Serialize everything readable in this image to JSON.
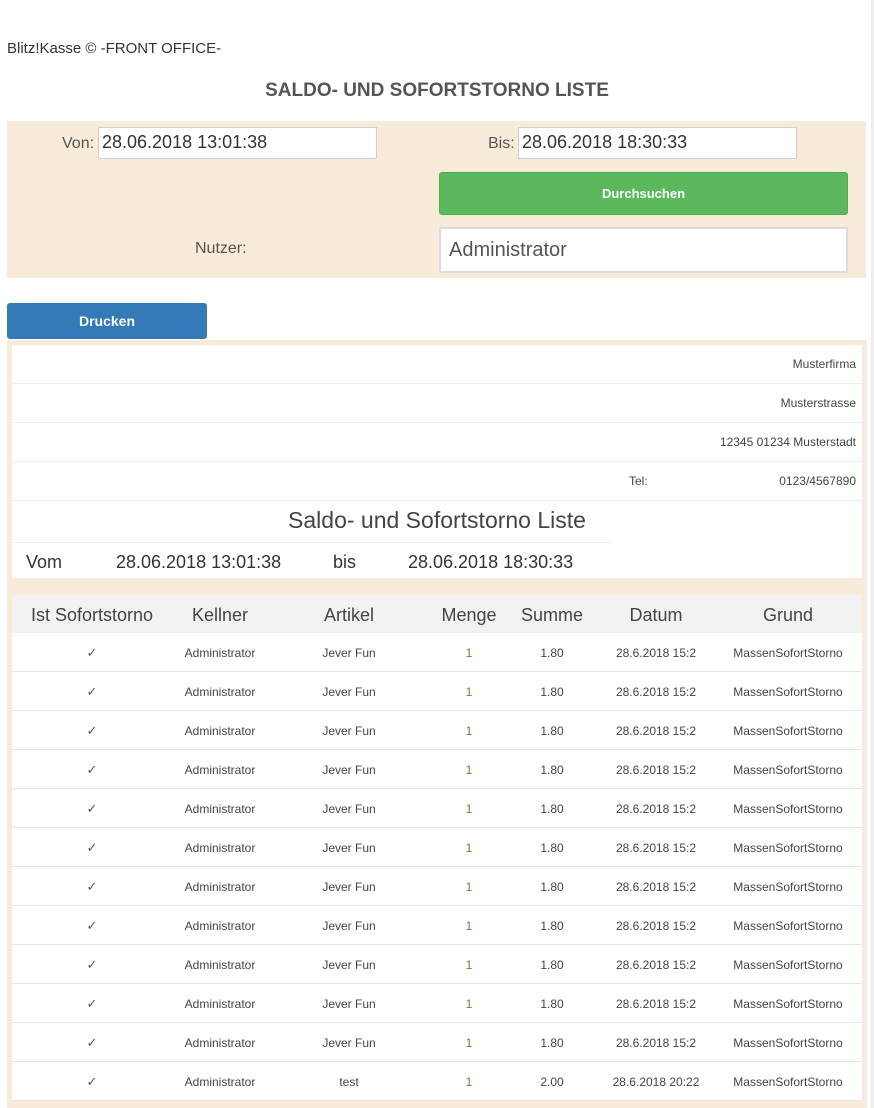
{
  "app": {
    "title": "Blitz!Kasse © -FRONT OFFICE-"
  },
  "page": {
    "heading": "SALDO- UND SOFORTSTORNO LISTE"
  },
  "filters": {
    "from_label": "Von:",
    "from_value": "28.06.2018 13:01:38",
    "to_label": "Bis:",
    "to_value": "28.06.2018 18:30:33",
    "search_button": "Durchsuchen",
    "user_label": "Nutzer:",
    "user_value": "Administrator"
  },
  "print_button": "Drucken",
  "report": {
    "company": "Musterfirma",
    "street": "Musterstrasse",
    "city": "12345 01234 Musterstadt",
    "tel_label": "Tel:",
    "tel_value": "0123/4567890",
    "title": "Saldo- und Sofortstorno Liste",
    "from_label": "Vom",
    "from_value": "28.06.2018 13:01:38",
    "to_label": "bis",
    "to_value": "28.06.2018 18:30:33"
  },
  "table": {
    "columns": [
      "Ist Sofortstorno",
      "Kellner",
      "Artikel",
      "Menge",
      "Summe",
      "Datum",
      "Grund"
    ],
    "rows": [
      [
        "✓",
        "Administrator",
        "Jever Fun",
        "1",
        "1.80",
        "28.6.2018 15:2",
        "MassenSofortStorno"
      ],
      [
        "✓",
        "Administrator",
        "Jever Fun",
        "1",
        "1.80",
        "28.6.2018 15:2",
        "MassenSofortStorno"
      ],
      [
        "✓",
        "Administrator",
        "Jever Fun",
        "1",
        "1.80",
        "28.6.2018 15:2",
        "MassenSofortStorno"
      ],
      [
        "✓",
        "Administrator",
        "Jever Fun",
        "1",
        "1.80",
        "28.6.2018 15:2",
        "MassenSofortStorno"
      ],
      [
        "✓",
        "Administrator",
        "Jever Fun",
        "1",
        "1.80",
        "28.6.2018 15:2",
        "MassenSofortStorno"
      ],
      [
        "✓",
        "Administrator",
        "Jever Fun",
        "1",
        "1.80",
        "28.6.2018 15:2",
        "MassenSofortStorno"
      ],
      [
        "✓",
        "Administrator",
        "Jever Fun",
        "1",
        "1.80",
        "28.6.2018 15:2",
        "MassenSofortStorno"
      ],
      [
        "✓",
        "Administrator",
        "Jever Fun",
        "1",
        "1.80",
        "28.6.2018 15:2",
        "MassenSofortStorno"
      ],
      [
        "✓",
        "Administrator",
        "Jever Fun",
        "1",
        "1.80",
        "28.6.2018 15:2",
        "MassenSofortStorno"
      ],
      [
        "✓",
        "Administrator",
        "Jever Fun",
        "1",
        "1.80",
        "28.6.2018 15:2",
        "MassenSofortStorno"
      ],
      [
        "✓",
        "Administrator",
        "Jever Fun",
        "1",
        "1.80",
        "28.6.2018 15:2",
        "MassenSofortStorno"
      ],
      [
        "✓",
        "Administrator",
        "test",
        "1",
        "2.00",
        "28.6.2018 20:22",
        "MassenSofortStorno"
      ]
    ]
  },
  "colors": {
    "panel_bg": "#f9ebd9",
    "search_button": "#5cb85c",
    "print_button": "#337ab7",
    "header_row": "#f2f2f2"
  }
}
